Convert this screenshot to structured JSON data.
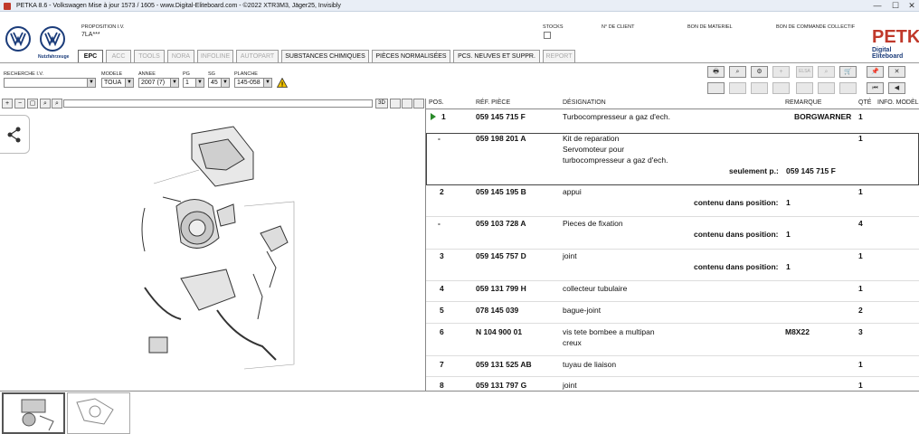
{
  "window": {
    "title": "PETKA 8.6 - Volkswagen Mise à jour 1573 / 1605 -  www.Digital-Eliteboard.com - ©2022 XTR3M3, Jäger25, Invisibly",
    "minimize": "—",
    "maximize": "☐",
    "close": "✕"
  },
  "brand": {
    "nutzfahrzeuge": "Nutzfahrzeuge",
    "petka": "PETKA",
    "digital": "Digital Eliteboard"
  },
  "header": {
    "proposition_label": "PROPOSITION I.V.",
    "proposition_value": "7LA***",
    "stocks_label": "STOCKS",
    "client_label": "N° DE CLIENT",
    "materiel_label": "BON DE MATERIEL",
    "commande_label": "BON DE COMMANDE COLLECTIF"
  },
  "tabs": [
    {
      "label": "EPC"
    },
    {
      "label": "ACC"
    },
    {
      "label": "TOOLS"
    },
    {
      "label": "NORA"
    },
    {
      "label": "INFOLINE"
    },
    {
      "label": "AUTOPART"
    },
    {
      "label": "SUBSTANCES CHIMIQUES"
    },
    {
      "label": "PIÈCES NORMALISÉES"
    },
    {
      "label": "PCS. NEUVES ET SUPPR."
    },
    {
      "label": "REPORT"
    }
  ],
  "filters": {
    "recherche_label": "RECHERCHE I.V.",
    "recherche_value": "",
    "modele_label": "MODELE",
    "modele_value": "TOUA",
    "annee_label": "ANNEE",
    "annee_value": "2007 (7)",
    "pg_label": "PG",
    "pg_value": "1",
    "sg_label": "SG",
    "sg_value": "45",
    "planche_label": "PLANCHE",
    "planche_value": "145-058",
    "dropdown_glyph": "▼",
    "warning_glyph": "!"
  },
  "toolbar": {
    "print": "🖶",
    "search": "⌕",
    "car": "⚙",
    "plus": "+",
    "elsa": "ELSA",
    "search2": "⌕",
    "cart": "🛒",
    "pin": "📌",
    "close": "✕",
    "first": "⏮",
    "prev": "◀"
  },
  "view": {
    "label_3d": "3D",
    "zoom_in": "+",
    "zoom_out": "−",
    "zoom_fit": "▢",
    "zoom_search": "⌕"
  },
  "table": {
    "headers": {
      "pos": "POS.",
      "ref": "RÉF. PIÈCE",
      "designation": "DÉSIGNATION",
      "remarque": "REMARQUE",
      "qte": "QTÉ",
      "info": "INFO. MODÈL"
    },
    "rows": [
      {
        "pos": "1",
        "ref": "059 145 715 F",
        "designation": "Turbocompresseur a gaz d'ech.",
        "remarque": "BORGWARNER",
        "qte": "1"
      },
      {
        "pos": "-",
        "ref": "059 198 201 A",
        "designation_lines": [
          "Kit de reparation",
          "Servomoteur pour",
          "turbocompresseur a gaz d'ech."
        ],
        "note_label": "seulement p.:",
        "note_value": "059 145 715 F",
        "qte": "1"
      },
      {
        "pos": "2",
        "ref": "059 145 195 B",
        "designation": "appui",
        "note_label": "contenu dans position:",
        "note_value": "1",
        "qte": "1"
      },
      {
        "pos": "-",
        "ref": "059 103 728 A",
        "designation": "Pieces de fixation",
        "note_label": "contenu dans position:",
        "note_value": "1",
        "qte": "4"
      },
      {
        "pos": "3",
        "ref": "059 145 757 D",
        "designation": "joint",
        "note_label": "contenu dans position:",
        "note_value": "1",
        "qte": "1"
      },
      {
        "pos": "4",
        "ref": "059 131 799 H",
        "designation": "collecteur tubulaire",
        "qte": "1"
      },
      {
        "pos": "5",
        "ref": "078 145 039",
        "designation": "bague-joint",
        "qte": "2"
      },
      {
        "pos": "6",
        "ref": "N   104 900 01",
        "designation_lines": [
          "vis tete bombee a multipan",
          "creux"
        ],
        "remarque": "M8X22",
        "qte": "3"
      },
      {
        "pos": "7",
        "ref": "059 131 525 AB",
        "designation": "tuyau de liaison",
        "qte": "1"
      },
      {
        "pos": "8",
        "ref": "059 131 797 G",
        "designation": "joint",
        "qte": "1"
      }
    ]
  },
  "drawing_labels": [
    "28",
    "27",
    "25",
    "24",
    "23",
    "26",
    "12",
    "11",
    "10",
    "9",
    "8",
    "7",
    "6",
    "5",
    "4",
    "3",
    "2",
    "1",
    "13",
    "14",
    "15",
    "16",
    "17",
    "18",
    "19",
    "20",
    "21",
    "22"
  ]
}
